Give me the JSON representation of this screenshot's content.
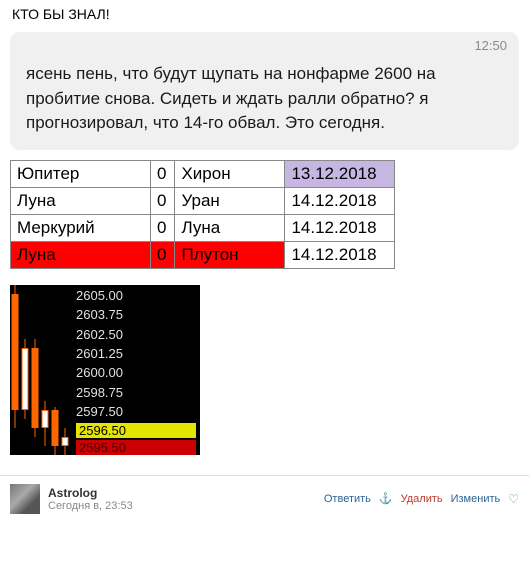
{
  "post": {
    "header": "КТО БЫ ЗНАЛ!"
  },
  "message": {
    "time": "12:50",
    "text": "ясень пень, что будут щупать на нонфарме 2600 на пробитие снова. Сидеть и ждать ралли обратно? я прогнозировал, что 14-го обвал. Это сегодня."
  },
  "astro_rows": [
    {
      "p1": "Юпитер",
      "asp": "0",
      "p2": "Хирон",
      "date": "13.12.2018",
      "date_hl": "purple"
    },
    {
      "p1": "Луна",
      "asp": "0",
      "p2": "Уран",
      "date": "14.12.2018"
    },
    {
      "p1": "Меркурий",
      "asp": "0",
      "p2": "Луна",
      "date": "14.12.2018"
    },
    {
      "p1": "Луна",
      "asp": "0",
      "p2": "Плутон",
      "date": "14.12.2018",
      "row_hl": "red"
    }
  ],
  "chart_data": {
    "type": "candlestick",
    "title": "",
    "y_ticks": [
      "2605.00",
      "2603.75",
      "2602.50",
      "2601.25",
      "2600.00",
      "2598.75",
      "2597.50",
      "2596.50",
      "2595.50"
    ],
    "tick_styles": {
      "6_index_comment": "0-based",
      "7": "yellow",
      "8": "red"
    },
    "ylim": [
      2595.5,
      2605.0
    ],
    "candles": [
      {
        "o": 2604.5,
        "h": 2605.0,
        "l": 2597.0,
        "c": 2598.0,
        "dir": "down"
      },
      {
        "o": 2598.0,
        "h": 2602.0,
        "l": 2597.5,
        "c": 2601.5,
        "dir": "up"
      },
      {
        "o": 2601.5,
        "h": 2602.0,
        "l": 2596.5,
        "c": 2597.0,
        "dir": "down"
      },
      {
        "o": 2597.0,
        "h": 2598.5,
        "l": 2596.0,
        "c": 2598.0,
        "dir": "up"
      },
      {
        "o": 2598.0,
        "h": 2598.2,
        "l": 2595.5,
        "c": 2596.0,
        "dir": "down"
      },
      {
        "o": 2596.0,
        "h": 2597.0,
        "l": 2595.5,
        "c": 2596.5,
        "dir": "up"
      }
    ]
  },
  "footer": {
    "author": "Astrolog",
    "time": "Сегодня в, 23:53",
    "actions": {
      "reply": "Ответить",
      "delete": "Удалить",
      "edit": "Изменить"
    }
  }
}
